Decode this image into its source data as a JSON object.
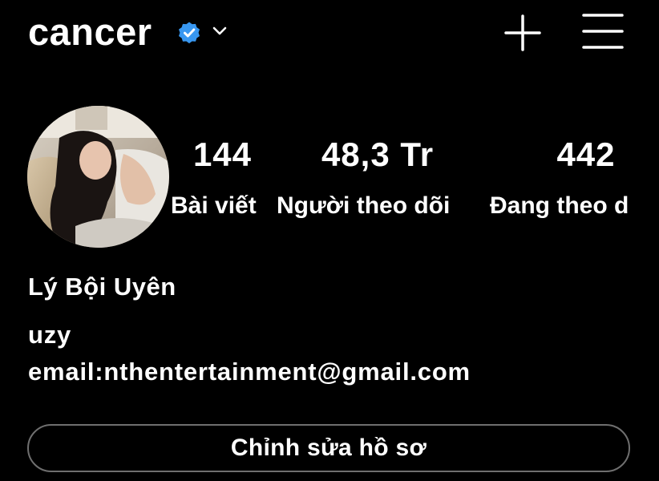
{
  "header": {
    "username": "cancer",
    "verified_icon": "verified-badge-icon",
    "dropdown_icon": "chevron-down-icon",
    "new_post_icon": "plus-icon",
    "menu_icon": "hamburger-menu-icon"
  },
  "profile": {
    "avatar_alt": "profile-photo",
    "stats": [
      {
        "value": "144",
        "label": "Bài viết"
      },
      {
        "value": "48,3 Tr",
        "label": "Người theo dõi"
      },
      {
        "value": "442",
        "label": "Đang theo d"
      }
    ],
    "full_name": "Lý Bội Uyên",
    "bio": [
      "uzy",
      "email:nthentertainment@gmail.com"
    ],
    "edit_button": "Chỉnh sửa hồ sơ"
  },
  "colors": {
    "background": "#000000",
    "text": "#ffffff",
    "verified": "#3897f0",
    "button_border": "#6f6f6f"
  }
}
